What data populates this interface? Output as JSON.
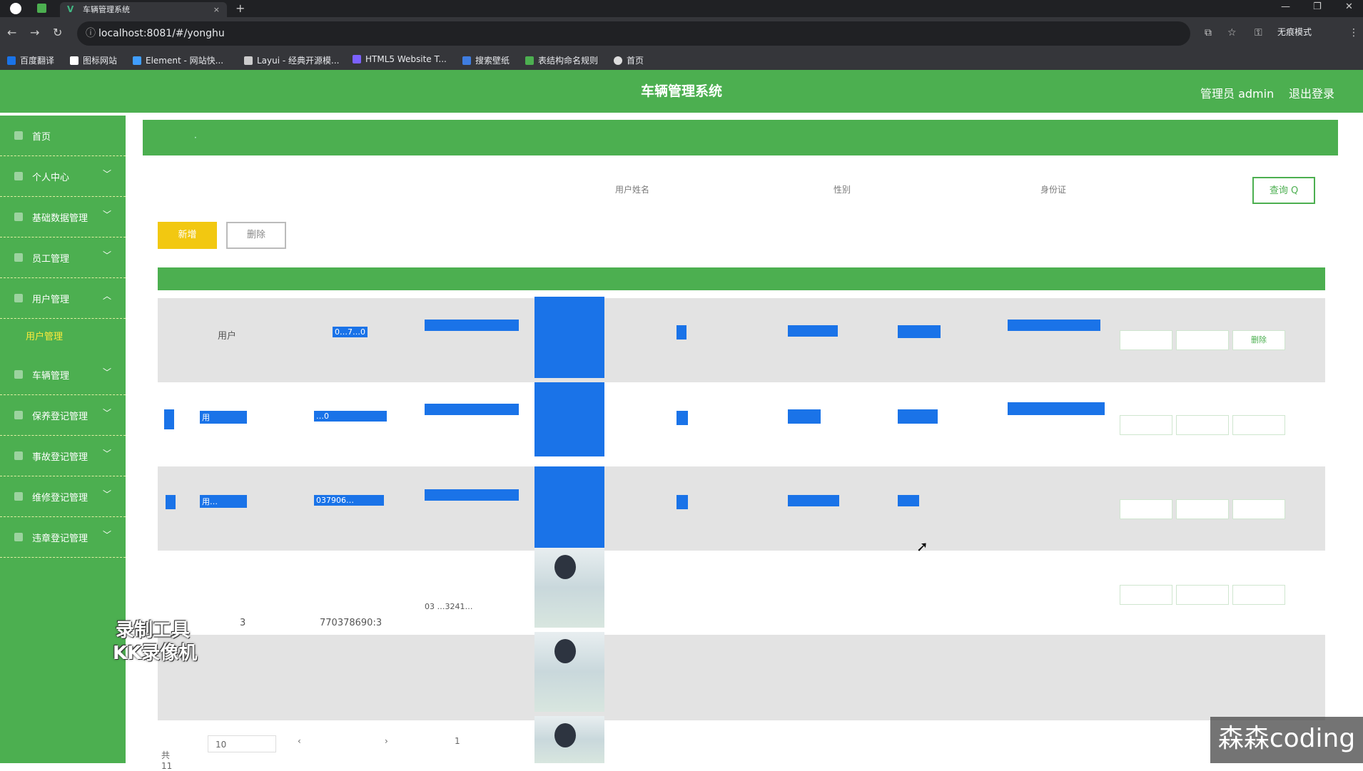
{
  "browser": {
    "tab_title": "车辆管理系统",
    "tab_close": "×",
    "new_tab": "+",
    "url": "localhost:8081/#/yonghu",
    "incognito": "无痕模式",
    "bookmarks": [
      "百度翻译",
      "图标网站",
      "Element - 网站快...",
      "Layui - 经典开源模...",
      "HTML5 Website T...",
      "搜索壁纸",
      "表结构命名规则",
      "首页"
    ]
  },
  "header": {
    "title": "车辆管理系统",
    "admin": "管理员 admin",
    "logout": "退出登录"
  },
  "sidebar": {
    "items": [
      {
        "label": "首页",
        "chevron": ""
      },
      {
        "label": "个人中心",
        "chevron": "﹀"
      },
      {
        "label": "基础数据管理",
        "chevron": "﹀"
      },
      {
        "label": "员工管理",
        "chevron": "﹀"
      },
      {
        "label": "用户管理",
        "chevron": "︿"
      },
      {
        "label": "车辆管理",
        "chevron": "﹀"
      },
      {
        "label": "保养登记管理",
        "chevron": "﹀"
      },
      {
        "label": "事故登记管理",
        "chevron": "﹀"
      },
      {
        "label": "维修登记管理",
        "chevron": "﹀"
      },
      {
        "label": "违章登记管理",
        "chevron": "﹀"
      }
    ],
    "subitem": "用户管理"
  },
  "filters": {
    "label1": "用户姓名",
    "label2": "性别",
    "label3": "身份证",
    "search": "查询 Q"
  },
  "toolbar": {
    "add": "新增",
    "delete": "删除"
  },
  "table": {
    "rows": [
      {
        "col1": "用户",
        "phone": "0…7…0"
      },
      {
        "col1": "用",
        "phone": "…0"
      },
      {
        "col1": "用…",
        "phone": "037906…"
      },
      {
        "col1": "3",
        "phone": "770378690:3",
        "id": "03 …3241…"
      },
      {
        "col1": "",
        "phone": ""
      }
    ],
    "actions": {
      "delete": "删除"
    }
  },
  "pager": {
    "total": "共11",
    "size": "10",
    "prev": "‹",
    "page": "1",
    "next": "›"
  },
  "watermarks": {
    "line1": "录制工具",
    "line2": "KK录像机",
    "brand": "森森coding"
  },
  "colors": {
    "primary": "#4caf50",
    "add_button": "#f2c811",
    "highlight": "#1a73e8"
  }
}
